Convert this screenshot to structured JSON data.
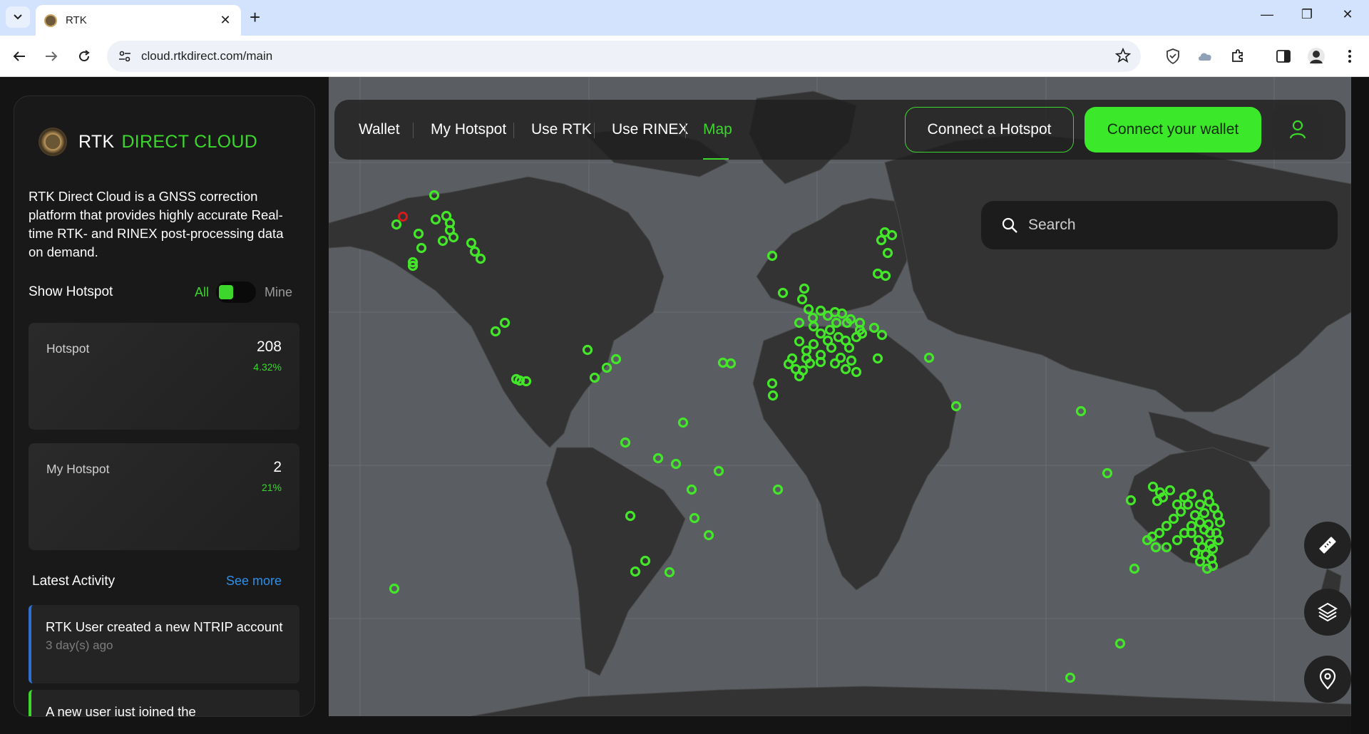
{
  "browser": {
    "tab_title": "RTK",
    "url": "cloud.rtkdirect.com/main"
  },
  "sidebar": {
    "brand_name": "RTK",
    "brand_accent": "DIRECT CLOUD",
    "intro": "RTK Direct Cloud is a GNSS correction platform that provides highly accurate Real-time RTK- and RINEX post-processing data on demand.",
    "show_hotspot": {
      "label": "Show Hotspot",
      "all": "All",
      "mine": "Mine",
      "toggle_state": "All"
    },
    "stats": [
      {
        "label": "Hotspot",
        "value": "208",
        "pct": "4.32%"
      },
      {
        "label": "My Hotspot",
        "value": "2",
        "pct": "21%"
      }
    ],
    "activity": {
      "title": "Latest Activity",
      "see_more": "See more",
      "items": [
        {
          "text": "RTK User created a new NTRIP account",
          "time": "3 day(s) ago"
        },
        {
          "text": "A new user just joined the",
          "time": ""
        }
      ]
    }
  },
  "topnav": {
    "links": [
      "Wallet",
      "My Hotspot",
      "Use RTK",
      "Use RINEX",
      "Map"
    ],
    "active": "Map",
    "connect_hotspot": "Connect a Hotspot",
    "connect_wallet": "Connect your wallet"
  },
  "search": {
    "placeholder": "Search"
  },
  "map_tools": [
    "ruler-icon",
    "layers-icon",
    "location-pin-icon"
  ],
  "colors": {
    "accent": "#3cd62c",
    "link": "#2f8fe8",
    "map_water": "#5a5d62",
    "map_land": "#333333"
  }
}
